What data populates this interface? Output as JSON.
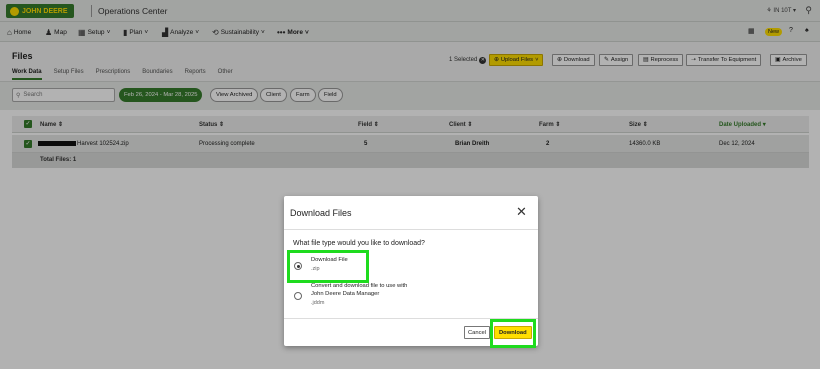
{
  "header": {
    "brand": "JOHN DEERE",
    "app_title": "Operations Center",
    "org": "IN 10T",
    "user_icon": "person-icon"
  },
  "nav": {
    "items": [
      {
        "label": "Home",
        "icon": "home-icon"
      },
      {
        "label": "Map",
        "icon": "map-icon"
      },
      {
        "label": "Setup",
        "icon": "setup-icon"
      },
      {
        "label": "Plan",
        "icon": "plan-icon"
      },
      {
        "label": "Analyze",
        "icon": "analyze-icon"
      },
      {
        "label": "Sustainability",
        "icon": "sustainability-icon"
      },
      {
        "label": "More",
        "icon": "more-icon"
      }
    ],
    "new_badge": "New"
  },
  "files": {
    "title": "Files",
    "tabs": [
      "Work Data",
      "Setup Files",
      "Prescriptions",
      "Boundaries",
      "Reports",
      "Other"
    ]
  },
  "toolbar": {
    "selected": "1 Selected",
    "upload": "Upload Files",
    "download": "Download",
    "assign": "Assign",
    "reprocess": "Reprocess",
    "transfer": "Transfer To Equipment",
    "archive": "Archive"
  },
  "filters": {
    "search_placeholder": "Search",
    "date_range": "Feb 26, 2024 - Mar 28, 2025",
    "view_archived": "View Archived",
    "client": "Client",
    "farm": "Farm",
    "field": "Field"
  },
  "table": {
    "columns": [
      "Name",
      "Status",
      "Field",
      "Client",
      "Farm",
      "Size",
      "Date Uploaded"
    ],
    "rows": [
      {
        "name": "Harvest 102524.zip",
        "status": "Processing complete",
        "field": "5",
        "client": "Brian Dreith",
        "farm": "2",
        "size": "14360.0 KB",
        "date": "Dec 12, 2024"
      }
    ],
    "total": "Total Files: 1"
  },
  "modal": {
    "title": "Download Files",
    "question": "What file type would you like to download?",
    "option1_label": "Download File",
    "option1_ext": ".zip",
    "option2_label_line1": "Convert and download file to use with",
    "option2_label_line2": "John Deere Data Manager",
    "option2_ext": ".jddm",
    "cancel": "Cancel",
    "download": "Download"
  },
  "colors": {
    "brand_green": "#367c2b",
    "brand_yellow": "#ffde00",
    "highlight_green": "#1edb1e"
  }
}
